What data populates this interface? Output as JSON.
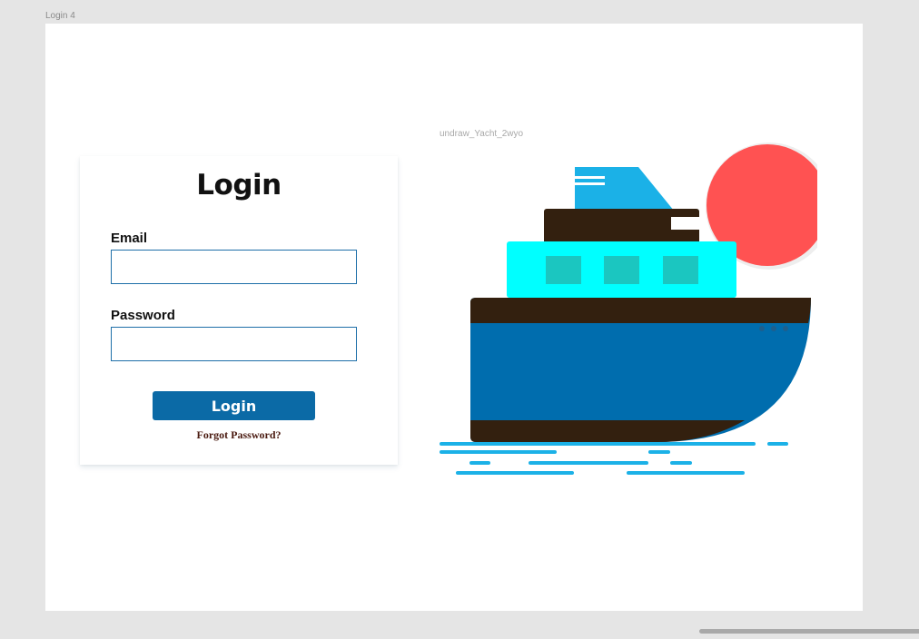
{
  "frame": {
    "label": "Login 4"
  },
  "login_card": {
    "title": "Login",
    "email_label": "Email",
    "email_value": "",
    "password_label": "Password",
    "password_value": "",
    "button_label": "Login",
    "forgot_label": "Forgot Password?"
  },
  "illustration": {
    "label": "undraw_Yacht_2wyo",
    "colors": {
      "sun": "#ff5252",
      "chimney": "#1bb1e7",
      "dark": "#33200f",
      "cabin": "#00ffff",
      "windows": "#1bc6c0",
      "hull": "#006dae",
      "water": "#1bb1e7"
    }
  },
  "theme": {
    "accent": "#0b6aa6",
    "input_border": "#1e6fa8",
    "canvas_bg": "#e5e5e5",
    "artboard_bg": "#ffffff"
  }
}
